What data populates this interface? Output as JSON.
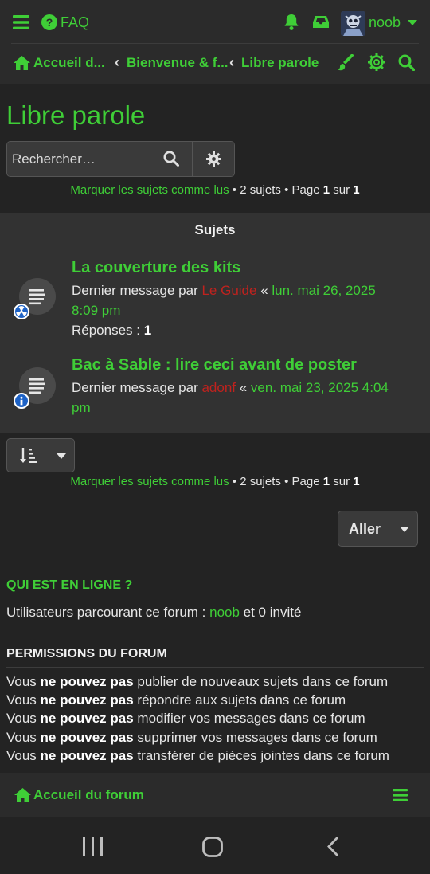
{
  "header": {
    "faq_label": "FAQ",
    "username": "noob",
    "icons": [
      "menu-icon",
      "question-circle-icon",
      "bell-icon",
      "inbox-icon",
      "caret-down-icon",
      "brush-icon",
      "cog-icon",
      "search-icon"
    ]
  },
  "breadcrumbs": [
    {
      "label": "Accueil d..."
    },
    {
      "label": "Bienvenue & f..."
    },
    {
      "label": "Libre parole"
    }
  ],
  "page": {
    "title": "Libre parole",
    "search_placeholder": "Rechercher…"
  },
  "stats_top": {
    "mark_read": "Marquer les sujets comme lus",
    "count_text": " • 2 sujets • Page ",
    "page": "1",
    "sur": " sur ",
    "total": "1"
  },
  "topics": {
    "header": "Sujets",
    "items": [
      {
        "title": "La couverture des kits",
        "last_by_prefix": "Dernier message par ",
        "author": "Le Guide",
        "separator": " « ",
        "date_line1": "lun. mai 26, 2025",
        "date_line2": "8:09 pm",
        "replies_label": "Réponses : ",
        "replies": "1",
        "badge": "radiation-badge-icon"
      },
      {
        "title": "Bac à Sable : lire ceci avant de poster",
        "last_by_prefix": "Dernier message par ",
        "author": "adonf",
        "separator": " « ",
        "date_line1": "ven. mai 23, 2025 4:04",
        "date_line2": "pm",
        "badge": "info-badge-icon"
      }
    ]
  },
  "stats_bottom": {
    "mark_read": "Marquer les sujets comme lus",
    "count_text": " • 2 sujets • Page ",
    "page": "1",
    "sur": " sur ",
    "total": "1"
  },
  "jump": {
    "label": "Aller"
  },
  "online": {
    "title": "QUI EST EN LIGNE ?",
    "prefix": "Utilisateurs parcourant ce forum : ",
    "user": "noob",
    "suffix": " et 0 invité"
  },
  "permissions": {
    "title": "PERMISSIONS DU FORUM",
    "lines": [
      {
        "a": "Vous ",
        "b": "ne pouvez pas",
        "c": " publier de nouveaux sujets dans ce forum"
      },
      {
        "a": "Vous ",
        "b": "ne pouvez pas",
        "c": " répondre aux sujets dans ce forum"
      },
      {
        "a": "Vous ",
        "b": "ne pouvez pas",
        "c": " modifier vos messages dans ce forum"
      },
      {
        "a": "Vous ",
        "b": "ne pouvez pas",
        "c": " supprimer vos messages dans ce forum"
      },
      {
        "a": "Vous ",
        "b": "ne pouvez pas",
        "c": " transférer de pièces jointes dans ce forum"
      }
    ]
  },
  "footer": {
    "home_label": "Accueil du forum"
  },
  "colors": {
    "accent": "#3fce37",
    "background": "#232323",
    "panel": "#323232",
    "author_red": "#c0221e"
  }
}
